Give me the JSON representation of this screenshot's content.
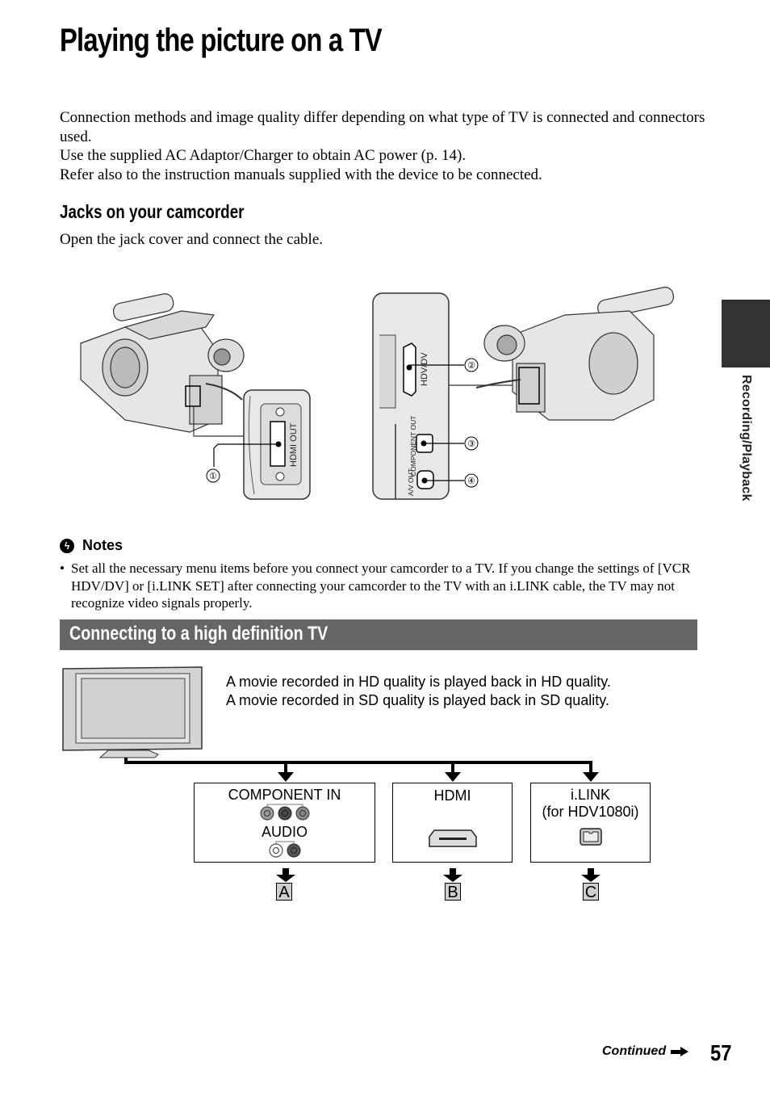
{
  "page": {
    "title": "Playing the picture on a TV",
    "intro": [
      "Connection methods and image quality differ depending on what type of TV is connected and connectors used.",
      "Use the supplied AC Adaptor/Charger to obtain AC power (p. 14).",
      "Refer also to the instruction manuals supplied with the device to be connected."
    ],
    "section_jacks": {
      "heading": "Jacks on your camcorder",
      "instruction": "Open the jack cover and connect the cable.",
      "left_figure": {
        "jack_label": "HDMI OUT",
        "callout": "①"
      },
      "right_figure": {
        "jack_labels": [
          "HDV/DV",
          "COMPONENT OUT",
          "A/V OUT"
        ],
        "callouts": [
          "②",
          "③",
          "④"
        ]
      }
    },
    "side_tab": {
      "label": "Recording/Playback"
    },
    "notes": {
      "heading": "Notes",
      "items": [
        "Set all the necessary menu items before you connect your camcorder to a TV. If you change the settings of [VCR HDV/DV] or [i.LINK SET] after connecting your camcorder to the TV with an i.LINK cable, the TV may not recognize video signals properly."
      ]
    },
    "section_hd": {
      "heading": "Connecting to a high definition TV",
      "description": [
        "A movie recorded in HD quality is played back in HD quality.",
        "A movie recorded in SD quality is played back in SD quality."
      ],
      "inputs": [
        {
          "label": "COMPONENT IN",
          "sublabel": "AUDIO",
          "badge": "A"
        },
        {
          "label": "HDMI",
          "badge": "B"
        },
        {
          "label": "i.LINK",
          "sublabel": "(for HDV1080i)",
          "badge": "C"
        }
      ]
    },
    "footer": {
      "continued": "Continued",
      "page_number": "57"
    }
  }
}
